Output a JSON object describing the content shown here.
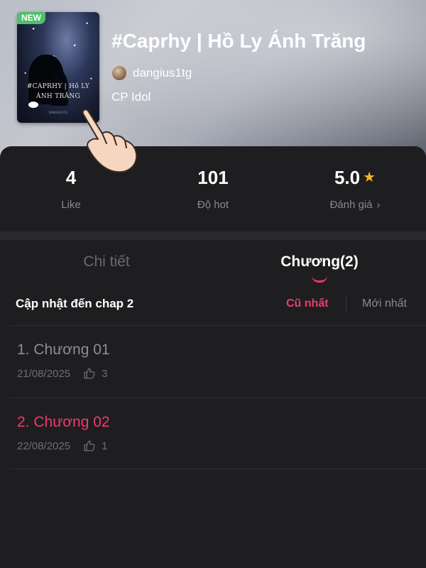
{
  "book": {
    "badge": "NEW",
    "title": "#Caprhy | Hồ Ly Ánh Trăng",
    "author": "dangius1tg",
    "category": "CP Idol",
    "cover_title": "#CAPRHY | Hồ LY ÁNH TRĂNG",
    "cover_author": "DANGIUS1TG"
  },
  "stats": {
    "likes": {
      "value": "4",
      "label": "Like"
    },
    "hot": {
      "value": "101",
      "label": "Độ hot"
    },
    "rating": {
      "value": "5.0",
      "label": "Đánh giá",
      "chevron": "›",
      "icon": "star-icon"
    }
  },
  "tabs": {
    "details": "Chi tiết",
    "chapters": "Chương(2)",
    "active": "chapters"
  },
  "update": {
    "label": "Cập nhật đến chap 2",
    "sort_oldest": "Cũ nhất",
    "sort_newest": "Mới nhất",
    "active_sort": "oldest"
  },
  "chapters": [
    {
      "title": "1. Chương 01",
      "date": "21/08/2025",
      "likes": "3",
      "highlighted": false
    },
    {
      "title": "2. Chương 02",
      "date": "22/08/2025",
      "likes": "1",
      "highlighted": true
    }
  ],
  "colors": {
    "accent": "#f03a6a",
    "badge": "#4fc06b",
    "star": "#f5b32a",
    "background": "#1e1e20"
  }
}
